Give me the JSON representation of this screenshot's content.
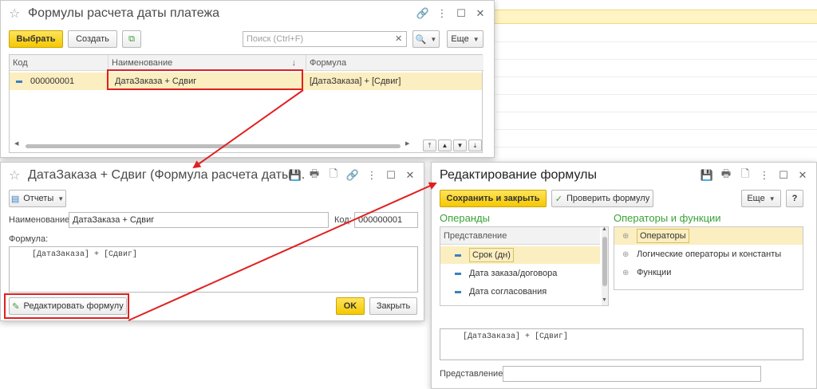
{
  "bg": {
    "line1": "...",
    "colors": {
      "highlight": "#fff5c4"
    }
  },
  "win1": {
    "title": "Формулы расчета даты платежа",
    "toolbar": {
      "select_label": "Выбрать",
      "create_label": "Создать",
      "search_placeholder": "Поиск (Ctrl+F)",
      "more_label": "Еще"
    },
    "columns": [
      "Код",
      "Наименование",
      "Формула"
    ],
    "rows": [
      {
        "code": "000000001",
        "name": "ДатаЗаказа + Сдвиг",
        "formula": "[ДатаЗаказа] + [Сдвиг]"
      }
    ]
  },
  "win2": {
    "title": "ДатаЗаказа + Сдвиг (Формула расчета даты ...",
    "reports_label": "Отчеты",
    "name_label": "Наименование:",
    "name_value": "ДатаЗаказа + Сдвиг",
    "code_label": "Код:",
    "code_value": "000000001",
    "formula_label": "Формула:",
    "formula_value": "[ДатаЗаказа] + [Сдвиг]",
    "edit_formula_label": "Редактировать формулу",
    "ok_label": "OK",
    "close_label": "Закрыть"
  },
  "win3": {
    "title": "Редактирование формулы",
    "save_close_label": "Сохранить и закрыть",
    "check_label": "Проверить формулу",
    "more_label": "Еще",
    "help_label": "?",
    "operands_title": "Операнды",
    "operators_title": "Операторы и функции",
    "operands_header": "Представление",
    "operands": [
      "Срок (дн)",
      "Дата заказа/договора",
      "Дата согласования"
    ],
    "operators": [
      "Операторы",
      "Логические операторы и константы",
      "Функции"
    ],
    "formula_value": "[ДатаЗаказа] + [Сдвиг]",
    "representation_label": "Представление:",
    "representation_value": ""
  },
  "accent_color": "#e02020"
}
